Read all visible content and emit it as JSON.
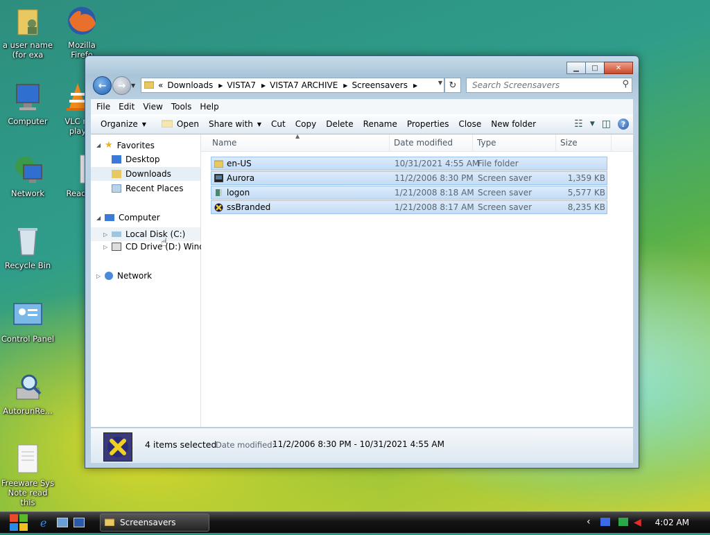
{
  "desktop": {
    "icons": [
      {
        "label_line1": "a user name",
        "label_line2": "(for exa"
      },
      {
        "label_line1": "Mozilla",
        "label_line2": "Firefo"
      },
      {
        "label_line1": "Computer",
        "label_line2": ""
      },
      {
        "label_line1": "VLC m",
        "label_line2": "play"
      },
      {
        "label_line1": "Network",
        "label_line2": ""
      },
      {
        "label_line1": "Read",
        "label_line2": ""
      },
      {
        "label_line1": "Recycle Bin",
        "label_line2": ""
      },
      {
        "label_line1": "Control Panel",
        "label_line2": ""
      },
      {
        "label_line1": "AutorunRe...",
        "label_line2": ""
      },
      {
        "label_line1": "Freeware Sys",
        "label_line2": "Note read this"
      }
    ]
  },
  "window": {
    "address": {
      "prefix": "«",
      "crumbs": [
        "Downloads",
        "VISTA7",
        "VISTA7 ARCHIVE",
        "Screensavers"
      ]
    },
    "search_placeholder": "Search Screensavers",
    "menu": [
      "File",
      "Edit",
      "View",
      "Tools",
      "Help"
    ],
    "toolbar": {
      "organize": "Organize",
      "open": "Open",
      "share_with": "Share with",
      "cut": "Cut",
      "copy": "Copy",
      "delete": "Delete",
      "rename": "Rename",
      "properties": "Properties",
      "close": "Close",
      "new_folder": "New folder"
    },
    "nav": {
      "favorites": "Favorites",
      "desktop": "Desktop",
      "downloads": "Downloads",
      "recent_places": "Recent Places",
      "computer": "Computer",
      "local_disk": "Local Disk (C:)",
      "cd_drive": "CD Drive (D:) Windo",
      "network": "Network"
    },
    "columns": [
      "Name",
      "Date modified",
      "Type",
      "Size"
    ],
    "files": [
      {
        "name": "en-US",
        "date": "10/31/2021 4:55 AM",
        "type": "File folder",
        "size": ""
      },
      {
        "name": "Aurora",
        "date": "11/2/2006 8:30 PM",
        "type": "Screen saver",
        "size": "1,359 KB"
      },
      {
        "name": "logon",
        "date": "1/21/2008 8:18 AM",
        "type": "Screen saver",
        "size": "5,577 KB"
      },
      {
        "name": "ssBranded",
        "date": "1/21/2008 8:17 AM",
        "type": "Screen saver",
        "size": "8,235 KB"
      }
    ],
    "details": {
      "selected": "4 items selected",
      "date_label": "Date modified:",
      "date_value": "11/2/2006 8:30 PM - 10/31/2021 4:55 AM"
    }
  },
  "taskbar": {
    "task": "Screensavers",
    "clock": "4:02 AM"
  },
  "colors": {
    "selection": "#cfe3f8",
    "accent": "#1e5fb2"
  }
}
